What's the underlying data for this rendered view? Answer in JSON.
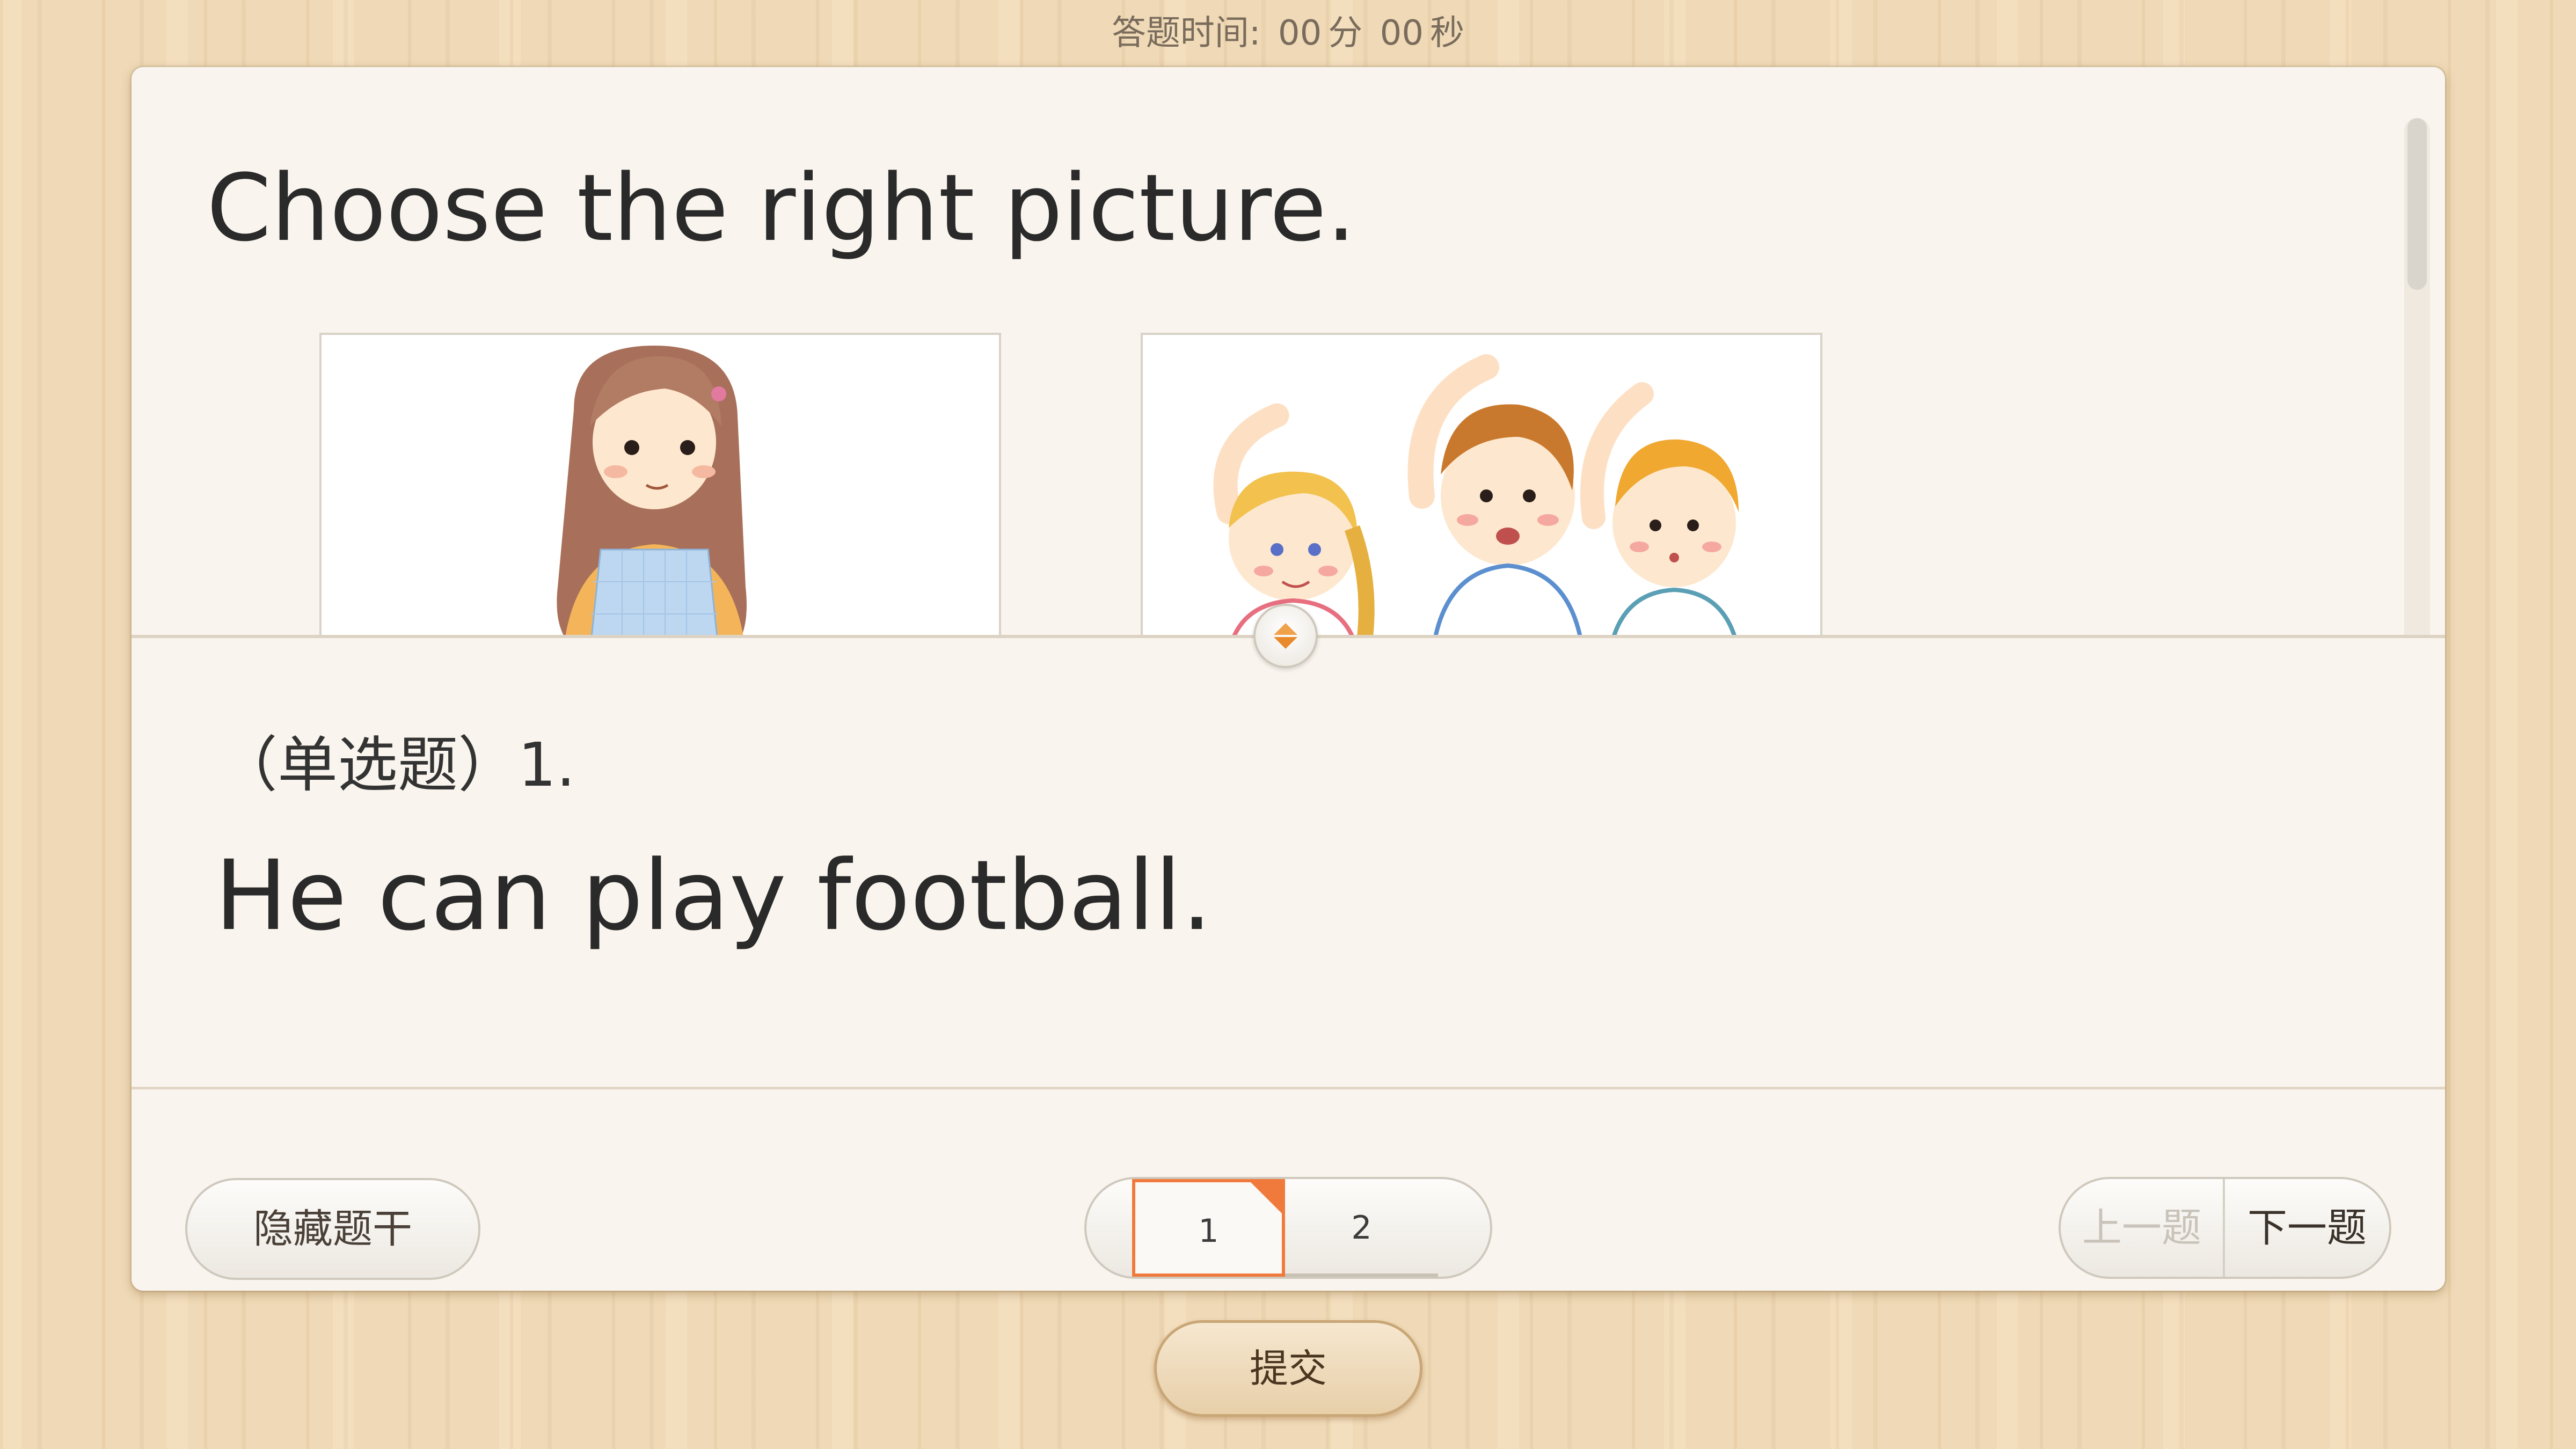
{
  "timer": {
    "label": "答题时间:",
    "minutes": "00",
    "minutes_unit": "分",
    "seconds": "00",
    "seconds_unit": "秒"
  },
  "stem": {
    "title": "Choose the right picture."
  },
  "question": {
    "type_label": "（单选题）1.",
    "text": "He can play football."
  },
  "footer": {
    "hide_stem_label": "隐藏题干",
    "pages": [
      "1",
      "2"
    ],
    "current_page": "1",
    "prev_label": "上一题",
    "next_label": "下一题"
  },
  "submit_label": "提交",
  "colors": {
    "accent": "#f07a3c",
    "card": "#f9f5ee",
    "wood": "#efd9b6"
  }
}
